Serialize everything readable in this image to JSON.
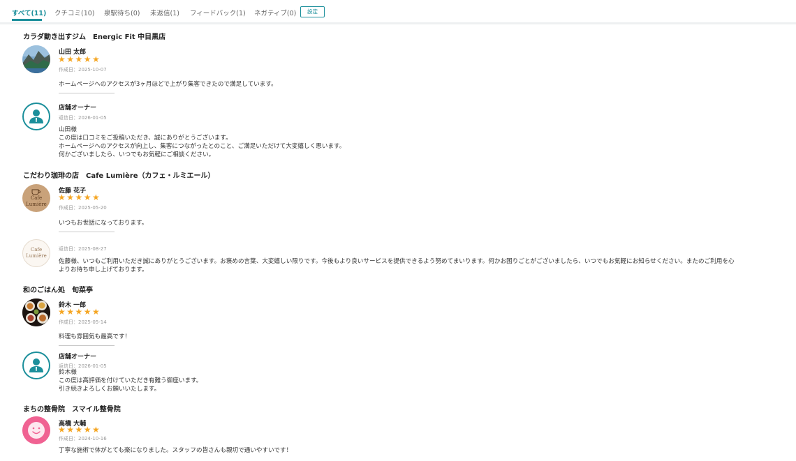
{
  "tabs": [
    {
      "label": "すべて(11)"
    },
    {
      "label": "クチコミ(10)"
    },
    {
      "label": "泉駅待ち(0)"
    },
    {
      "label": "未返信(1)"
    },
    {
      "label": "フィードバック(1)"
    },
    {
      "label": "ネガティブ(0)"
    }
  ],
  "settings_label": "設定",
  "colors": {
    "accent": "#1b8f9b",
    "star": "#f5a623",
    "pink": "#f06292"
  },
  "star_glyphs": "★★★★★",
  "reviews": [
    {
      "shop": "カラダ動き出すジム　Energic Fit 中目黒店",
      "author": "山田 太郎",
      "rating": 5,
      "created_label": "作成日：",
      "created": "2025-10-07",
      "body": "ホームページへのアクセスが3ヶ月ほどで上がり集客できたので満足しています。",
      "reply": {
        "author": "店舗オーナー",
        "date_label": "返信日：",
        "date": "2026-01-05",
        "lines": [
          "山田様",
          "この度は口コミをご投稿いただき、誠にありがとうございます。",
          "ホームページへのアクセスが向上し、集客につながったとのこと、ご満足いただけて大変嬉しく思います。",
          "何かございましたら、いつでもお気軽にご相談ください。"
        ]
      }
    },
    {
      "shop": "こだわり珈琲の店　Cafe Lumière（カフェ・ルミエール）",
      "author": "佐藤 花子",
      "rating": 5,
      "created_label": "作成日：",
      "created": "2025-05-20",
      "body": "いつもお世話になっております。",
      "logo_text": [
        "Cafe",
        "Lumière"
      ],
      "reply": {
        "date_label": "返信日：",
        "date": "2025-08-27",
        "lines": [
          "佐藤様、いつもご利用いただき誠にありがとうございます。お褒めの言葉、大変嬉しい限りです。今後もより良いサービスを提供できるよう努めてまいります。何かお困りごとがございましたら、いつでもお気軽にお知らせください。またのご利用を心",
          "よりお待ち申し上げております。"
        ]
      }
    },
    {
      "shop": "和のごはん処　旬菜亭",
      "author": "鈴木 一郎",
      "rating": 5,
      "created_label": "作成日：",
      "created": "2025-05-14",
      "body": "料理も雰囲気も最高です！",
      "reply": {
        "author": "店舗オーナー",
        "date_label": "返信日：",
        "date": "2026-01-05",
        "lines": [
          "鈴木様",
          "この度は高評価を付けていただき有難う御座います。",
          "引き続きよろしくお願いいたします。"
        ]
      }
    },
    {
      "shop": "まちの整骨院　スマイル整骨院",
      "author": "高橋 大輔",
      "rating": 5,
      "created_label": "作成日：",
      "created": "2024-10-16",
      "body": "丁寧な施術で体がとても楽になりました。スタッフの皆さんも親切で通いやすいです！"
    }
  ]
}
